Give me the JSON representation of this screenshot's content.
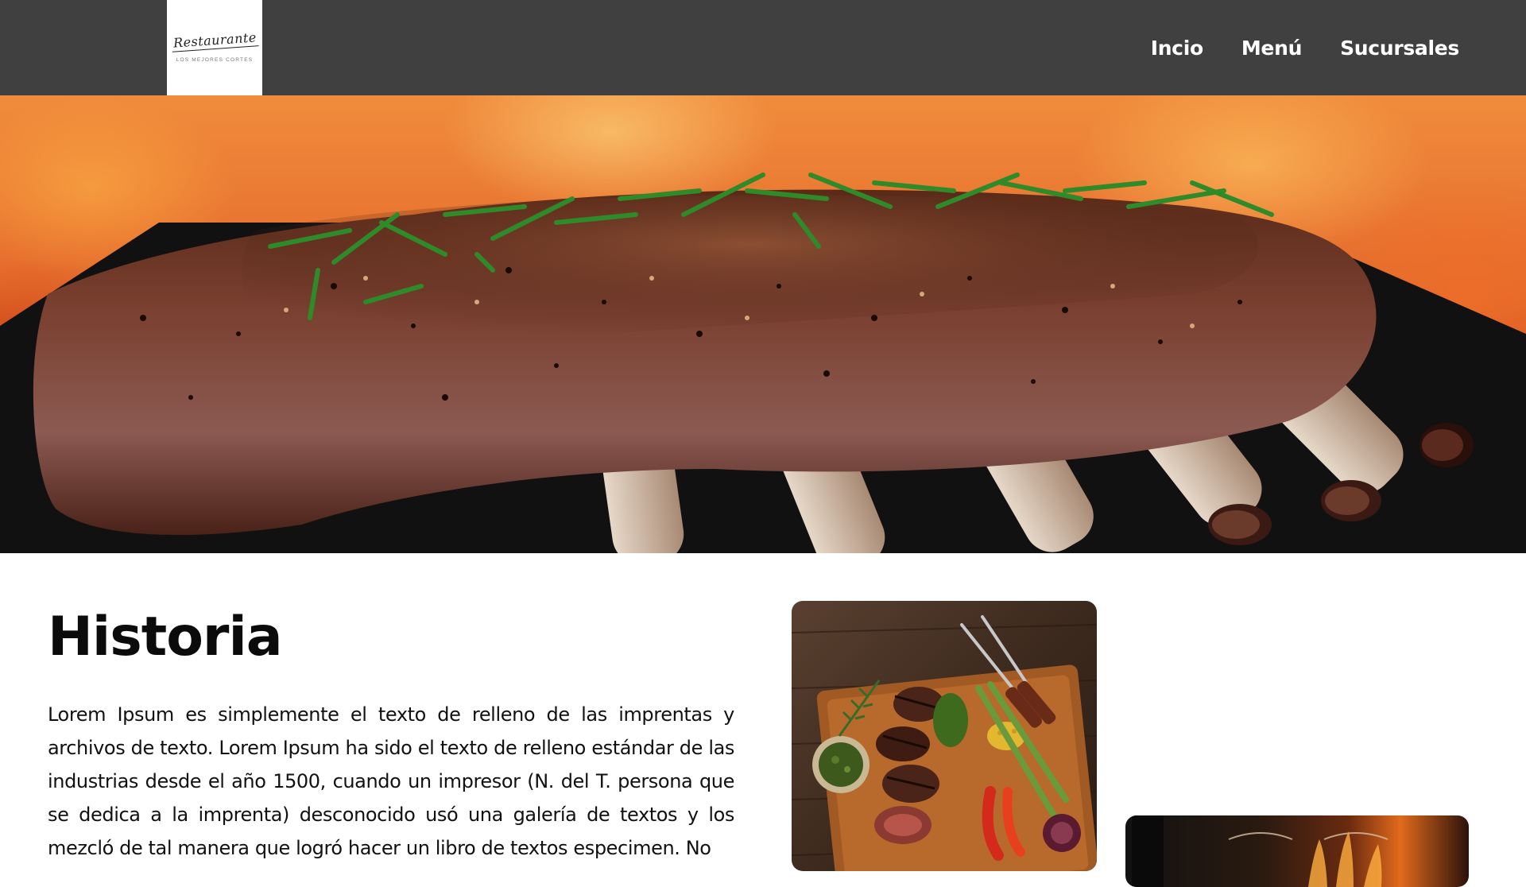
{
  "header": {
    "logo": {
      "script": "Restaurante",
      "tagline": "LOS MEJORES CORTES"
    },
    "nav": [
      {
        "label": "Incio"
      },
      {
        "label": "Menú"
      },
      {
        "label": "Sucursales"
      }
    ],
    "colors": {
      "background": "#404040",
      "text": "#ffffff"
    }
  },
  "hero": {
    "image": "grilled-rack-of-ribs-over-fire"
  },
  "history": {
    "title": "Historia",
    "body": "Lorem Ipsum es simplemente el texto de relleno de las imprentas y archivos de texto. Lorem Ipsum ha sido el texto de relleno estándar de las industrias desde el año 1500, cuando un impresor (N. del T. persona que se dedica a la imprenta) desconocido usó una galería de textos y los mezcló de tal manera que logró hacer un libro de textos especimen. No"
  },
  "gallery": [
    {
      "image": "steak-board-with-vegetables"
    },
    {
      "image": "wine-glasses-fireplace"
    }
  ]
}
